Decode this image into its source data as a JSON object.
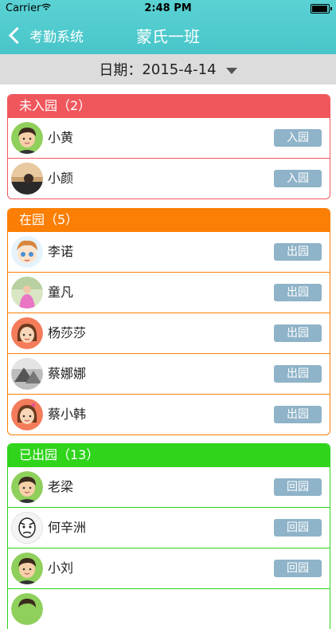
{
  "status": {
    "carrier": "Carrier",
    "time": "2:48 PM"
  },
  "nav": {
    "back_label": "考勤系统",
    "title": "蒙氏一班"
  },
  "date_selector": {
    "label": "日期：",
    "value": "2015-4-14"
  },
  "sections": [
    {
      "title": "未入园（2）",
      "color": "#f0575c",
      "rows": [
        {
          "name": "小黄",
          "action": "入园",
          "avatar": "boy-avatar"
        },
        {
          "name": "小颜",
          "action": "入园",
          "avatar": "photo-avatar"
        }
      ]
    },
    {
      "title": "在园（5）",
      "color": "#fb7f05",
      "rows": [
        {
          "name": "李诺",
          "action": "出园",
          "avatar": "cartoon-avatar"
        },
        {
          "name": "童凡",
          "action": "出园",
          "avatar": "photo-avatar"
        },
        {
          "name": "杨莎莎",
          "action": "出园",
          "avatar": "girl-avatar"
        },
        {
          "name": "蔡娜娜",
          "action": "出园",
          "avatar": "photo-avatar"
        },
        {
          "name": "蔡小韩",
          "action": "出园",
          "avatar": "girl-avatar"
        }
      ]
    },
    {
      "title": "已出园（13）",
      "color": "#2fd41b",
      "rows": [
        {
          "name": "老梁",
          "action": "回园",
          "avatar": "boy-avatar"
        },
        {
          "name": "何辛洲",
          "action": "回园",
          "avatar": "meme-avatar"
        },
        {
          "name": "小刘",
          "action": "回园",
          "avatar": "boy-avatar"
        }
      ]
    }
  ]
}
